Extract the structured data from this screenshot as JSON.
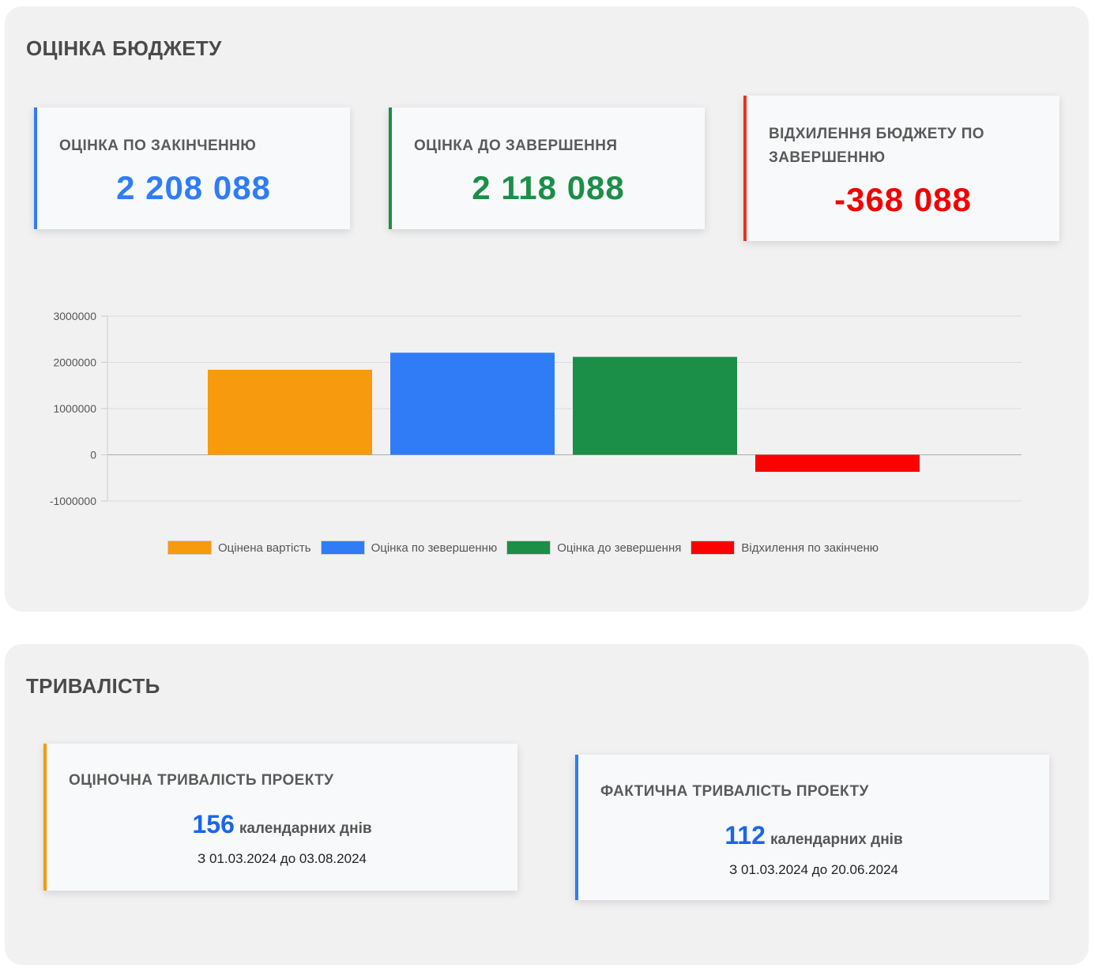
{
  "budget": {
    "title": "ОЦІНКА БЮДЖЕТУ",
    "cards": [
      {
        "label": "ОЦІНКА ПО ЗАКІНЧЕННЮ",
        "value": "2 208 088",
        "color": "#2f7cf6"
      },
      {
        "label": "ОЦІНКА ДО ЗАВЕРШЕННЯ",
        "value": "2 118 088",
        "color": "#1b8e47"
      },
      {
        "label": "ВІДХИЛЕННЯ БЮДЖЕТУ ПО ЗАВЕРШЕННЮ",
        "value": "-368 088",
        "color": "#f20000"
      }
    ]
  },
  "chart_data": {
    "type": "bar",
    "categories": [
      "Оцінена вартість",
      "Оцінка по зевершенню",
      "Оцінка до зевершення",
      "Відхилення по закінченю"
    ],
    "values": [
      1840000,
      2208088,
      2118088,
      -368088
    ],
    "colors": [
      "#f79a0e",
      "#2f7cf6",
      "#1b8e47",
      "#ff0000"
    ],
    "ylim": [
      -1000000,
      3000000
    ],
    "yticks": [
      "3000000",
      "2000000",
      "1000000",
      "0",
      "-1000000"
    ],
    "legend_position": "bottom",
    "grid": true
  },
  "duration": {
    "title": "ТРИВАЛІСТЬ",
    "estimated": {
      "label": "ОЦІНОЧНА ТРИВАЛІСТЬ ПРОЕКТУ",
      "days": "156",
      "unit": "календарних днів",
      "range": "З 01.03.2024 до 03.08.2024",
      "color": "#f79a0e"
    },
    "actual": {
      "label": "ФАКТИЧНА ТРИВАЛІСТЬ ПРОЕКТУ",
      "days": "112",
      "unit": "календарних днів",
      "range": "З 01.03.2024 до 20.06.2024",
      "color": "#2f7cf6"
    }
  }
}
